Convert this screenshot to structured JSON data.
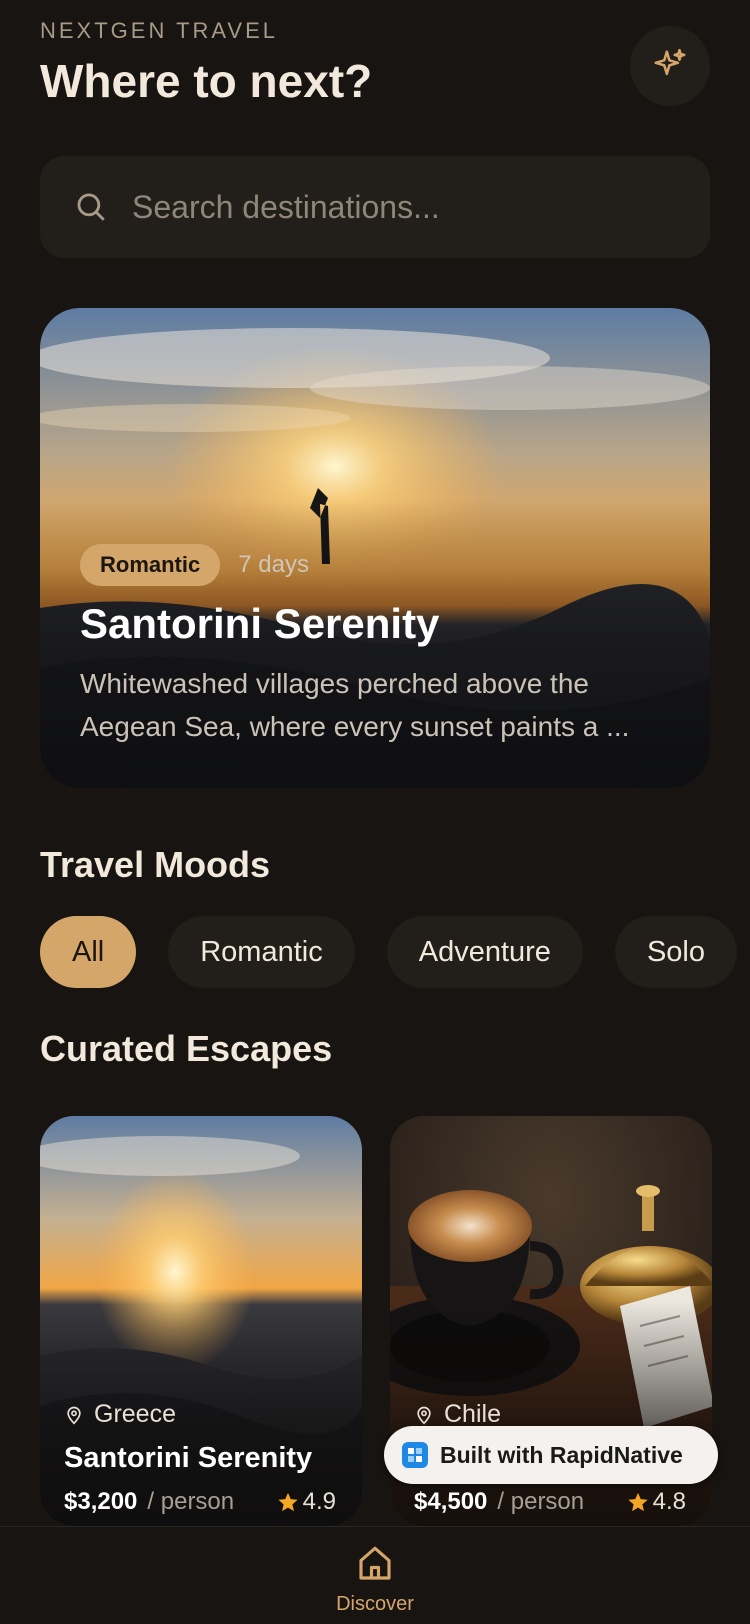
{
  "header": {
    "brand": "NEXTGEN TRAVEL",
    "title": "Where to next?",
    "sparkle_icon": "sparkles-icon"
  },
  "search": {
    "placeholder": "Search destinations...",
    "icon": "search-icon"
  },
  "featured": {
    "tag": "Romantic",
    "duration": "7 days",
    "title": "Santorini Serenity",
    "description": "Whitewashed villages perched above the Aegean Sea, where every sunset paints a ..."
  },
  "moods": {
    "title": "Travel Moods",
    "chips": [
      {
        "label": "All",
        "active": true
      },
      {
        "label": "Romantic",
        "active": false
      },
      {
        "label": "Adventure",
        "active": false
      },
      {
        "label": "Solo",
        "active": false
      }
    ]
  },
  "escapes": {
    "title": "Curated Escapes",
    "cards": [
      {
        "location": "Greece",
        "title": "Santorini Serenity",
        "price": "$3,200",
        "per": "/ person",
        "rating": "4.9"
      },
      {
        "location": "Chile",
        "title": "",
        "price": "$4,500",
        "per": "/ person",
        "rating": "4.8"
      }
    ]
  },
  "badge": {
    "label": "Built with RapidNative"
  },
  "nav": {
    "discover": "Discover"
  },
  "colors": {
    "accent": "#d4a66a",
    "background": "#171411",
    "surface": "#221e1a"
  }
}
